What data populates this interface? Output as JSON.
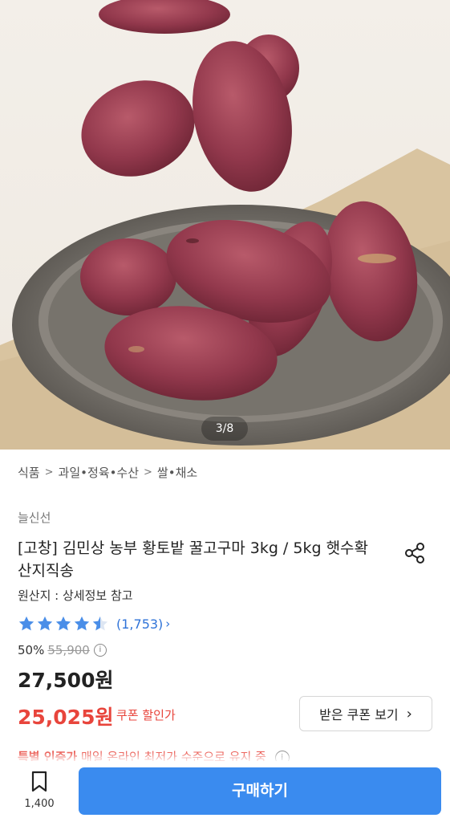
{
  "gallery": {
    "counter": "3/8"
  },
  "breadcrumb": [
    {
      "label": "식품"
    },
    {
      "label": "과일•정육•수산"
    },
    {
      "label": "쌀•채소"
    }
  ],
  "product": {
    "seller": "늘신선",
    "title": "[고창] 김민상 농부 황토밭 꿀고구마 3kg / 5kg 햇수확 산지직송",
    "origin": "원산지 : 상세정보 참고",
    "rating": {
      "stars": 4.5,
      "review_count": "(1,753)"
    },
    "discount_rate": "50%",
    "original_price": "55,900",
    "sale_price": "27,500원",
    "coupon_price": "25,025원",
    "coupon_label": "쿠폰 할인가",
    "coupon_button": "받은 쿠폰 보기"
  },
  "promo": {
    "label": "특별 인증가",
    "text": "매일 온라인 최저가 수준으로 유지 중"
  },
  "bottom_bar": {
    "bookmark_count": "1,400",
    "buy_label": "구매하기"
  },
  "icons": {
    "share": "share-icon",
    "bookmark": "bookmark-icon",
    "info": "info-icon",
    "star": "star-icon"
  },
  "colors": {
    "accent_blue": "#3a8bef",
    "star_blue": "#4a8ee8",
    "price_red": "#e8453c"
  }
}
